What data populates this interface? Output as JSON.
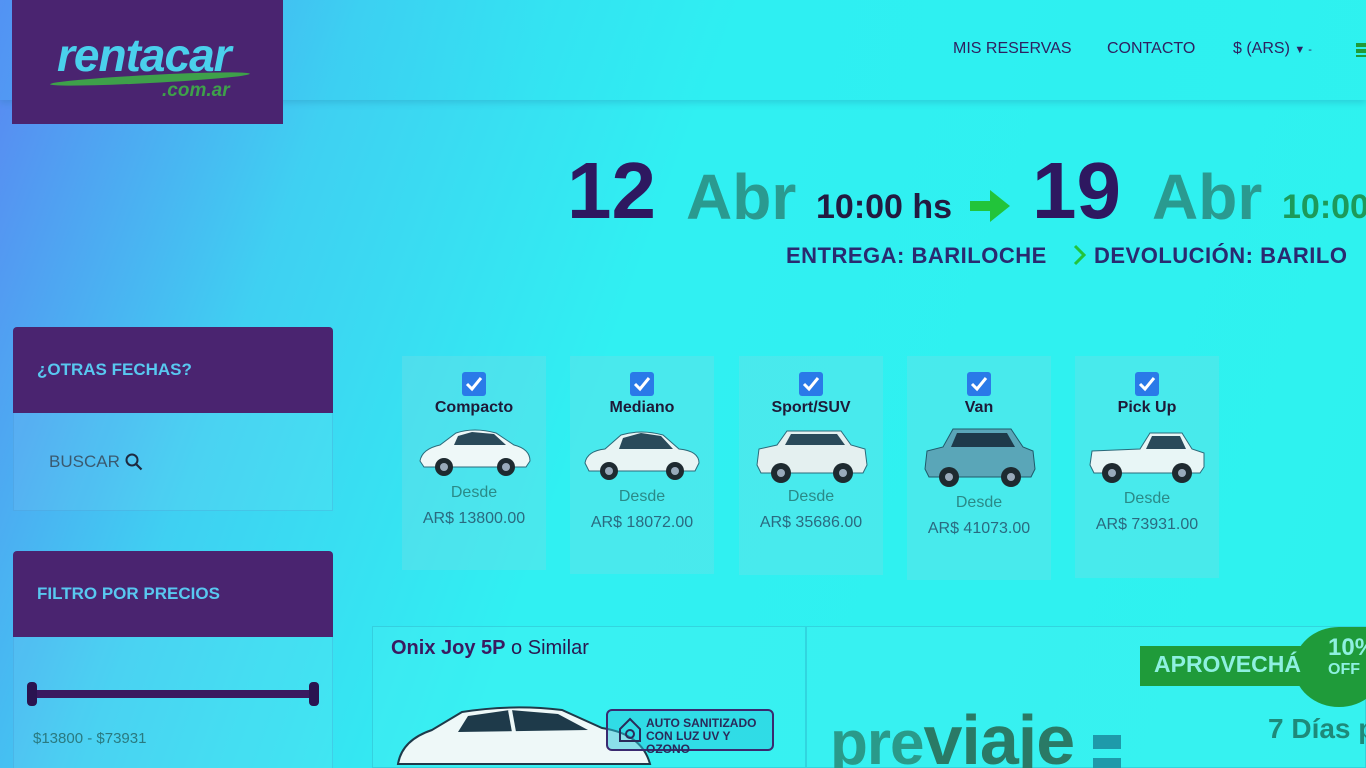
{
  "brand": {
    "name": "rentacar",
    "domain": ".com.ar"
  },
  "nav": {
    "reservations": "MIS RESERVAS",
    "contact": "CONTACTO",
    "currency": "$ (ARS)"
  },
  "trip": {
    "pickup_day": "12",
    "pickup_month": "Abr",
    "pickup_time": "10:00 hs",
    "return_day": "19",
    "return_month": "Abr",
    "return_time": "10:00",
    "pickup_label": "ENTREGA: BARILOCHE",
    "return_label": "DEVOLUCIÓN: BARILO"
  },
  "sidebar": {
    "dates_title": "¿OTRAS FECHAS?",
    "search_label": "BUSCAR",
    "price_filter_title": "FILTRO POR PRECIOS",
    "price_range": "$13800 - $73931",
    "price_min": 13800,
    "price_max": 73931,
    "slider_low": 0,
    "slider_high": 1
  },
  "categories": [
    {
      "name": "Compacto",
      "from": "Desde",
      "price": "AR$ 13800.00",
      "checked": true
    },
    {
      "name": "Mediano",
      "from": "Desde",
      "price": "AR$ 18072.00",
      "checked": true
    },
    {
      "name": "Sport/SUV",
      "from": "Desde",
      "price": "AR$ 35686.00",
      "checked": true
    },
    {
      "name": "Van",
      "from": "Desde",
      "price": "AR$ 41073.00",
      "checked": true
    },
    {
      "name": "Pick Up",
      "from": "Desde",
      "price": "AR$ 73931.00",
      "checked": true
    }
  ],
  "listing": {
    "model": "Onix Joy 5P",
    "similar": " o Similar",
    "sanitized_line1": "AUTO SANITIZADO",
    "sanitized_line2": "CON LUZ UV Y OZONO"
  },
  "promo": {
    "ribbon": "APROVECHÁ",
    "off_pct": "10%",
    "off_word": "OFF",
    "days": "7 Días p",
    "previaje_pre": "pre",
    "previaje_main": "viaje"
  }
}
